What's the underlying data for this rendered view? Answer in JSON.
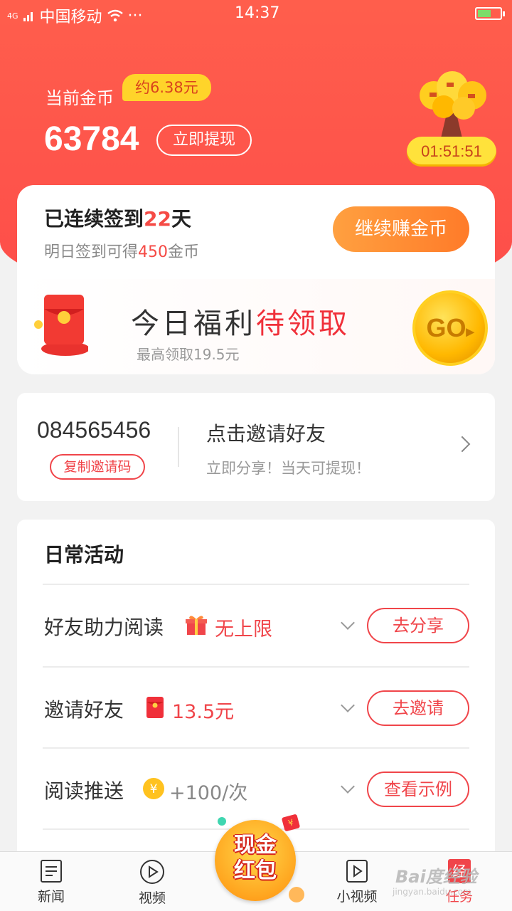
{
  "status_bar": {
    "network": "4G",
    "carrier": "中国移动",
    "more": "···",
    "time": "14:37"
  },
  "header": {
    "coins_label": "当前金币",
    "approx_value": "约6.38元",
    "coin_count": "63784",
    "withdraw_label": "立即提现",
    "timer": "01:51:51"
  },
  "signin": {
    "streak_prefix": "已连续签到",
    "streak_days": "22",
    "streak_suffix": "天",
    "tomorrow_prefix": "明日签到可得",
    "tomorrow_coins": "450",
    "tomorrow_suffix": "金币",
    "earn_button": "继续赚金币",
    "welfare_title": "今日福利",
    "welfare_highlight": "待领取",
    "welfare_sub": "最高领取19.5元",
    "go_label": "GO"
  },
  "invite": {
    "code": "084565456",
    "copy_button": "复制邀请码",
    "title": "点击邀请好友",
    "subtitle": "立即分享！当天可提现！"
  },
  "daily": {
    "title": "日常活动",
    "rows": [
      {
        "label": "好友助力阅读",
        "reward": "无上限",
        "icon": "gift-icon",
        "button": "去分享"
      },
      {
        "label": "邀请好友",
        "reward": "13.5元",
        "icon": "red-envelope-icon",
        "button": "去邀请"
      },
      {
        "label": "阅读推送",
        "reward": "+100/次",
        "icon": "yuan-coin-icon",
        "button": "查看示例"
      }
    ]
  },
  "tabbar": {
    "tabs": [
      {
        "label": "新闻"
      },
      {
        "label": "视频"
      },
      {
        "label": "小视频"
      },
      {
        "label": "任务"
      }
    ],
    "cash_line1": "现金",
    "cash_line2": "红包",
    "cash_tag": "¥",
    "tasks_badge": "经"
  },
  "watermark": {
    "logo": "Bai度经验",
    "url": "jingyan.baidu.com"
  },
  "colors": {
    "brand_red": "#fd4d4a",
    "accent_orange": "#ff8a2e",
    "gold": "#ffd42a"
  }
}
